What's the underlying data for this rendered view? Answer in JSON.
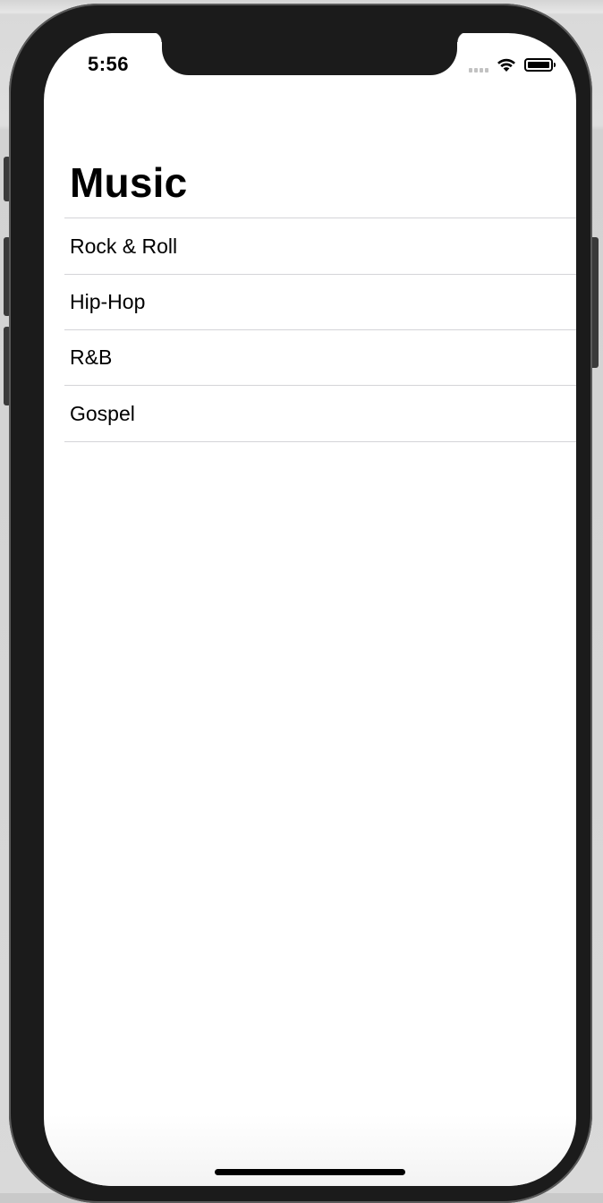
{
  "status_bar": {
    "time": "5:56",
    "icons": [
      "cellular-signal-icon",
      "wifi-icon",
      "battery-icon"
    ]
  },
  "navigation": {
    "title": "Music"
  },
  "list": {
    "items": [
      {
        "label": "Rock & Roll"
      },
      {
        "label": "Hip-Hop"
      },
      {
        "label": "R&B"
      },
      {
        "label": "Gospel"
      }
    ]
  }
}
